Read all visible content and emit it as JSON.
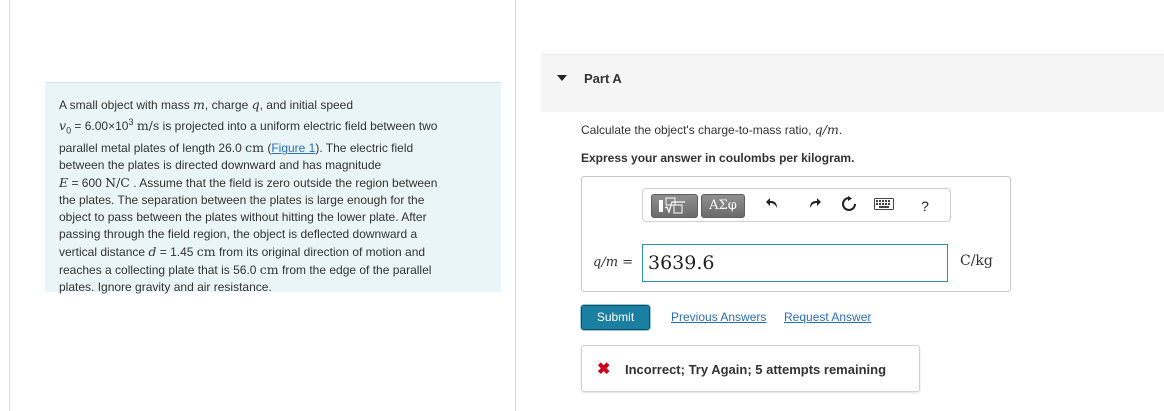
{
  "problem": {
    "line1": {
      "a": "A small object with mass ",
      "m": "m",
      "b": ", charge ",
      "q": "q",
      "c": ", and initial speed"
    },
    "line2": {
      "v": "v",
      "sub": "0",
      "a": " = 6.00×10",
      "exp": "3",
      "unit": "m/s",
      "b": " is projected into a uniform electric field between two"
    },
    "line3": {
      "a": "parallel metal plates of length 26.0 ",
      "unit": "cm",
      "b": " (",
      "link": "Figure 1",
      "c": "). The electric field"
    },
    "line4": "between the plates is directed downward and has magnitude",
    "line5": {
      "E": "E",
      "a": " = 600 ",
      "unit": "N/C",
      "b": " . Assume that the field is zero outside the region between"
    },
    "line6": "the plates. The separation between the plates is large enough for the",
    "line7": "object to pass between the plates without hitting the lower plate. After",
    "line8": "passing through the field region, the object is deflected downward a",
    "line9": {
      "a": "vertical distance ",
      "d": "d",
      "b": " = 1.45 ",
      "unit": "cm",
      "c": " from its original direction of motion and"
    },
    "line10": {
      "a": "reaches a collecting plate that is 56.0 ",
      "unit": "cm",
      "b": " from the edge of the parallel"
    },
    "line11": "plates. Ignore gravity and air resistance."
  },
  "part": {
    "title": "Part A"
  },
  "question": {
    "a": "Calculate the object's charge-to-mass ratio, ",
    "var": "q/m",
    "b": "."
  },
  "instruction": "Express your answer in coulombs per kilogram.",
  "toolbar": {
    "greek_label": "ΑΣφ",
    "icons": [
      "templates-icon",
      "greek-letters-icon",
      "undo-icon",
      "redo-icon",
      "reset-icon",
      "keyboard-icon",
      "help-icon"
    ],
    "help_label": "?"
  },
  "answer": {
    "label": "q/m =",
    "value": "3639.6",
    "unit": "C/kg"
  },
  "actions": {
    "submit": "Submit",
    "previous": "Previous Answers",
    "request": "Request Answer"
  },
  "feedback": {
    "text": "Incorrect; Try Again; 5 attempts remaining",
    "color": "#d0021b"
  },
  "colors": {
    "accent": "#1a7fa0",
    "link": "#2a6ebb",
    "problem_bg": "#e9f5f7"
  }
}
